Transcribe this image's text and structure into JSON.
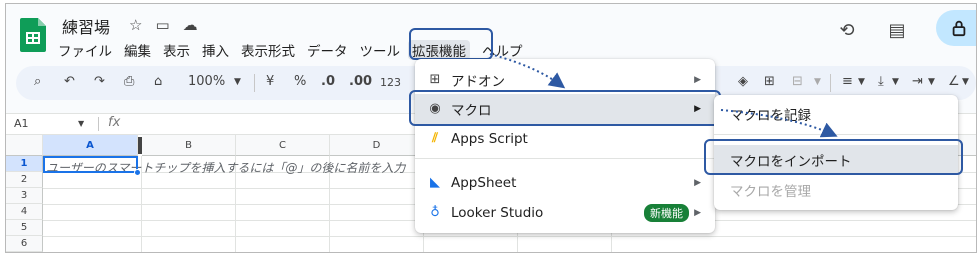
{
  "doc": {
    "title": "練習場"
  },
  "menubar": [
    "ファイル",
    "編集",
    "表示",
    "挿入",
    "表示形式",
    "データ",
    "ツール",
    "拡張機能",
    "ヘルプ"
  ],
  "toolbar": {
    "zoom": "100%",
    "currency": "¥",
    "percent": "%",
    "dec_dec": ".0",
    "dec_inc": ".00",
    "format_123": "123"
  },
  "namebox": {
    "value": "A1"
  },
  "formula": {
    "fx": "fx"
  },
  "columns": [
    "A",
    "B",
    "C",
    "D"
  ],
  "rows": [
    "1",
    "2",
    "3",
    "4",
    "5",
    "6"
  ],
  "cell_a1_hint": "ユーザーのスマートチップを挿入するには「@」の後に名前を入力",
  "extensions_menu": {
    "addons": "アドオン",
    "macros": "マクロ",
    "apps_script": "Apps Script",
    "appsheet": "AppSheet",
    "looker": "Looker Studio",
    "new_badge": "新機能"
  },
  "macros_submenu": {
    "record": "マクロを記録",
    "import": "マクロをインポート",
    "manage": "マクロを管理"
  },
  "colors": {
    "highlight_border": "#2e59a3",
    "select_blue": "#1a73e8",
    "badge_green": "#188038"
  }
}
